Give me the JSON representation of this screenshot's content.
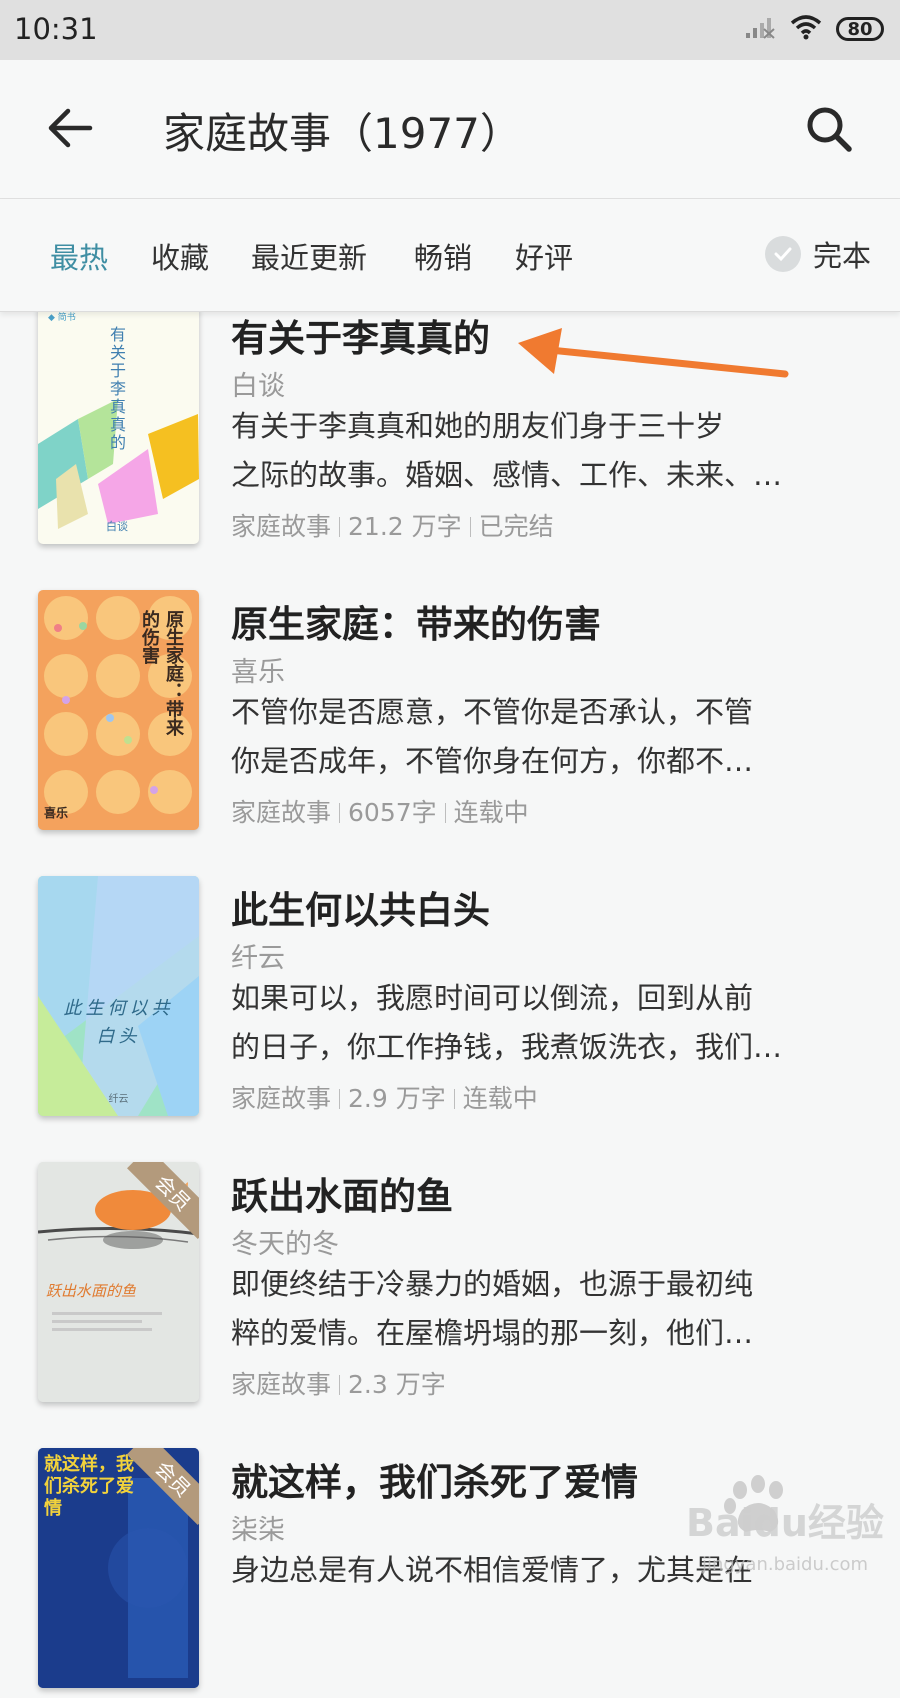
{
  "status_bar": {
    "time": "10:31",
    "battery": "80"
  },
  "header": {
    "title": "家庭故事（1977）"
  },
  "tabs": [
    "最热",
    "收藏",
    "最近更新",
    "畅销",
    "好评"
  ],
  "filter": {
    "complete_label": "完本"
  },
  "books": [
    {
      "title": "有关于李真真的",
      "author": "白谈",
      "desc": [
        "有关于李真真和她的朋友们身于三十岁",
        "之际的故事。婚姻、感情、工作、未来、…"
      ],
      "meta": [
        "家庭故事",
        "21.2 万字",
        "已完结"
      ],
      "cover_text": "有关于李真真的",
      "cover_author": "白谈"
    },
    {
      "title": "原生家庭：带来的伤害",
      "author": "喜乐",
      "desc": [
        "不管你是否愿意，不管你是否承认，不管",
        "你是否成年，不管你身在何方，你都不…"
      ],
      "meta": [
        "家庭故事",
        "6057字",
        "连载中"
      ],
      "cover_text_1": "原生家庭：带来",
      "cover_text_2": "的伤害",
      "cover_author": "喜乐"
    },
    {
      "title": "此生何以共白头",
      "author": "纤云",
      "desc": [
        "如果可以，我愿时间可以倒流，回到从前",
        "的日子，你工作挣钱，我煮饭洗衣，我们…"
      ],
      "meta": [
        "家庭故事",
        "2.9 万字",
        "连载中"
      ],
      "cover_text_1": "此生何以共",
      "cover_text_2": "白头",
      "cover_author": "纤云"
    },
    {
      "title": "跃出水面的鱼",
      "author": "冬天的冬",
      "desc": [
        "即便终结于冷暴力的婚姻，也源于最初纯",
        "粹的爱情。在屋檐坍塌的那一刻，他们…"
      ],
      "meta": [
        "家庭故事",
        "2.3 万字"
      ],
      "badge": "会员",
      "cover_text": "跃出水面的鱼"
    },
    {
      "title": "就这样，我们杀死了爱情",
      "author": "柒柒",
      "desc": [
        "身边总是有人说不相信爱情了，尤其是在"
      ],
      "badge": "会员",
      "cover_text": "就这样，我们杀死了爱情"
    }
  ],
  "watermark": {
    "brand": "Baidu经验",
    "url": "jingyan.baidu.com"
  }
}
